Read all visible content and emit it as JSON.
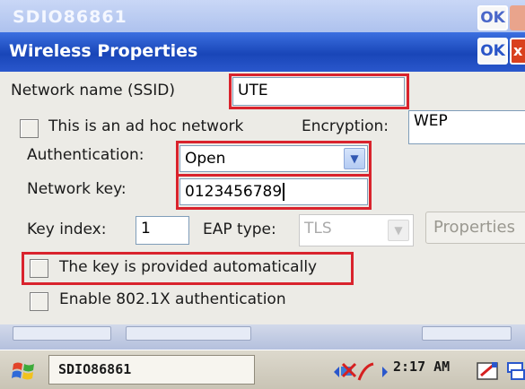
{
  "background_window": {
    "title": "SDIO86861",
    "ok_label": "OK"
  },
  "dialog": {
    "title": "Wireless Properties",
    "ok_label": "OK",
    "close_label": "x",
    "network_name": {
      "label": "Network name (SSID)",
      "value": "UTE"
    },
    "adhoc": {
      "label": "This is an ad hoc network",
      "checked": false
    },
    "encryption": {
      "label": "Encryption:",
      "value": "WEP"
    },
    "authentication": {
      "label": "Authentication:",
      "value": "Open"
    },
    "network_key": {
      "label": "Network key:",
      "value": "0123456789"
    },
    "key_index": {
      "label": "Key index:",
      "value": "1"
    },
    "eap_type": {
      "label": "EAP type:",
      "value": "TLS",
      "disabled": true
    },
    "properties_button": "Properties",
    "key_auto": {
      "label": "The key is provided automatically",
      "checked": false
    },
    "enable_8021x": {
      "label": "Enable 802.1X authentication",
      "checked": false
    }
  },
  "taskbar": {
    "task_label": "SDIO86861",
    "clock": "2:17 AM"
  },
  "colors": {
    "title_bar": "#1f4fc2",
    "highlight": "#d9232d",
    "dialog_bg": "#ecebe6",
    "taskbar_bg": "#d4d0c4"
  },
  "icons": [
    "windows-flag-icon",
    "network-icon",
    "volume-icon",
    "input-panel-icon",
    "desktop-icon"
  ]
}
